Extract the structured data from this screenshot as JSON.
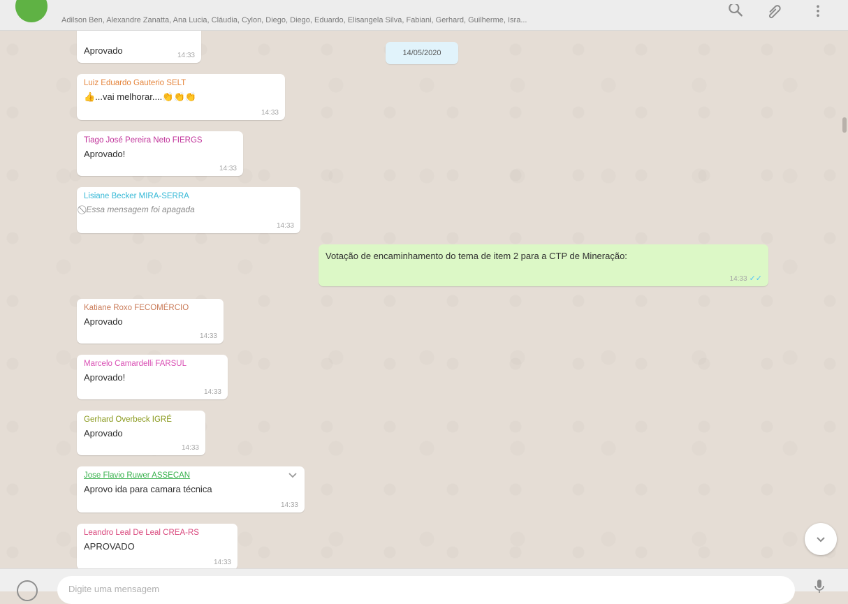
{
  "header": {
    "participants": "Adilson Ben, Alexandre Zanatta, Ana Lucia, Cláudia, Cylon, Diego, Diego, Eduardo, Elisangela Silva, Fabiani, Gerhard, Guilherme, Isra..."
  },
  "chat": {
    "date_chip": "14/05/2020",
    "messages": [
      {
        "sender": "",
        "text": "Aprovado",
        "time": "14:33"
      },
      {
        "sender": "Luiz Eduardo Gauterio SELT",
        "text": "👍...vai melhorar....👏👏👏",
        "time": "14:33"
      },
      {
        "sender": "Tiago José Pereira Neto FIERGS",
        "text": "Aprovado!",
        "time": "14:33"
      },
      {
        "sender": "Lisiane Becker MIRA-SERRA",
        "text": "Essa mensagem foi apagada",
        "time": "14:33"
      },
      {
        "sender": "",
        "text": "Votação de encaminhamento do tema de item 2 para a CTP de Mineração:",
        "time": "14:33",
        "ticks": "✓✓"
      },
      {
        "sender": "Katiane Roxo FECOMÉRCIO",
        "text": "Aprovado",
        "time": "14:33"
      },
      {
        "sender": "Marcelo Camardelli FARSUL",
        "text": "Aprovado!",
        "time": "14:33"
      },
      {
        "sender": "Gerhard Overbeck IGRÉ",
        "text": "Aprovado",
        "time": "14:33"
      },
      {
        "sender": "Jose Flavio Ruwer ASSECAN",
        "text": "Aprovo ida para camara técnica",
        "time": "14:33"
      },
      {
        "sender": "Leandro Leal De Leal CREA-RS",
        "text": "APROVADO",
        "time": "14:33"
      }
    ]
  },
  "footer": {
    "compose_placeholder": "Digite uma mensagem"
  },
  "colors": {
    "chat_bg": "#e5ddd5",
    "outgoing_bubble": "#dcf8c6",
    "incoming_bubble": "#ffffff",
    "date_chip": "#e1f3fb",
    "read_ticks": "#4fc3f7",
    "sender_orange": "#e5853d",
    "sender_magenta": "#c0329a",
    "sender_cyan": "#35b8d6",
    "sender_brown": "#c97a57",
    "sender_pink": "#d94fb4",
    "sender_olive": "#8a9a1e",
    "sender_green": "#3bb24f",
    "sender_rose": "#d9477c"
  },
  "icons": [
    "group-avatar",
    "search-icon",
    "attach-icon",
    "menu-icon",
    "chevron-down-icon",
    "deleted-icon",
    "emoji-icon",
    "mic-icon"
  ]
}
